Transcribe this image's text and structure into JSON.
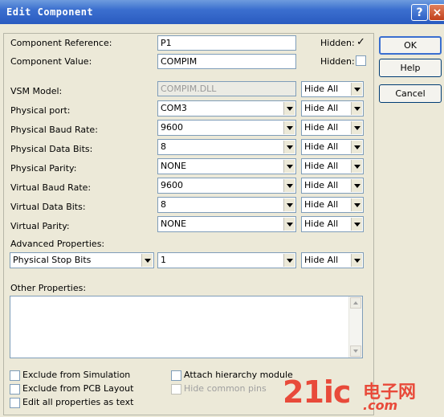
{
  "window": {
    "title": "Edit Component",
    "help_icon": "?",
    "close_icon": "×"
  },
  "fields": {
    "reference": {
      "label": "Component Reference:",
      "value": "P1",
      "hidden_label": "Hidden:",
      "hidden_checked": "✓"
    },
    "value": {
      "label": "Component Value:",
      "value": "COMPIM",
      "hidden_label": "Hidden:"
    }
  },
  "properties": [
    {
      "label": "VSM Model:",
      "value": "COMPIM.DLL",
      "visibility": "Hide All"
    },
    {
      "label": "Physical port:",
      "value": "COM3",
      "visibility": "Hide All"
    },
    {
      "label": "Physical Baud Rate:",
      "value": "9600",
      "visibility": "Hide All"
    },
    {
      "label": "Physical Data Bits:",
      "value": "8",
      "visibility": "Hide All"
    },
    {
      "label": "Physical Parity:",
      "value": "NONE",
      "visibility": "Hide All"
    },
    {
      "label": "Virtual Baud Rate:",
      "value": "9600",
      "visibility": "Hide All"
    },
    {
      "label": "Virtual Data Bits:",
      "value": "8",
      "visibility": "Hide All"
    },
    {
      "label": "Virtual Parity:",
      "value": "NONE",
      "visibility": "Hide All"
    }
  ],
  "advanced": {
    "label": "Advanced Properties:",
    "property": "Physical Stop Bits",
    "value": "1",
    "visibility": "Hide All"
  },
  "other": {
    "label": "Other Properties:"
  },
  "options": {
    "exclude_sim": "Exclude from Simulation",
    "exclude_pcb": "Exclude from PCB Layout",
    "edit_all": "Edit all properties as text",
    "attach_hier": "Attach hierarchy module",
    "hide_pins": "Hide common pins"
  },
  "buttons": {
    "ok": "OK",
    "help": "Help",
    "cancel": "Cancel"
  },
  "watermark": {
    "main": "21ic",
    "cn": "电子网",
    "dom": ".com"
  }
}
